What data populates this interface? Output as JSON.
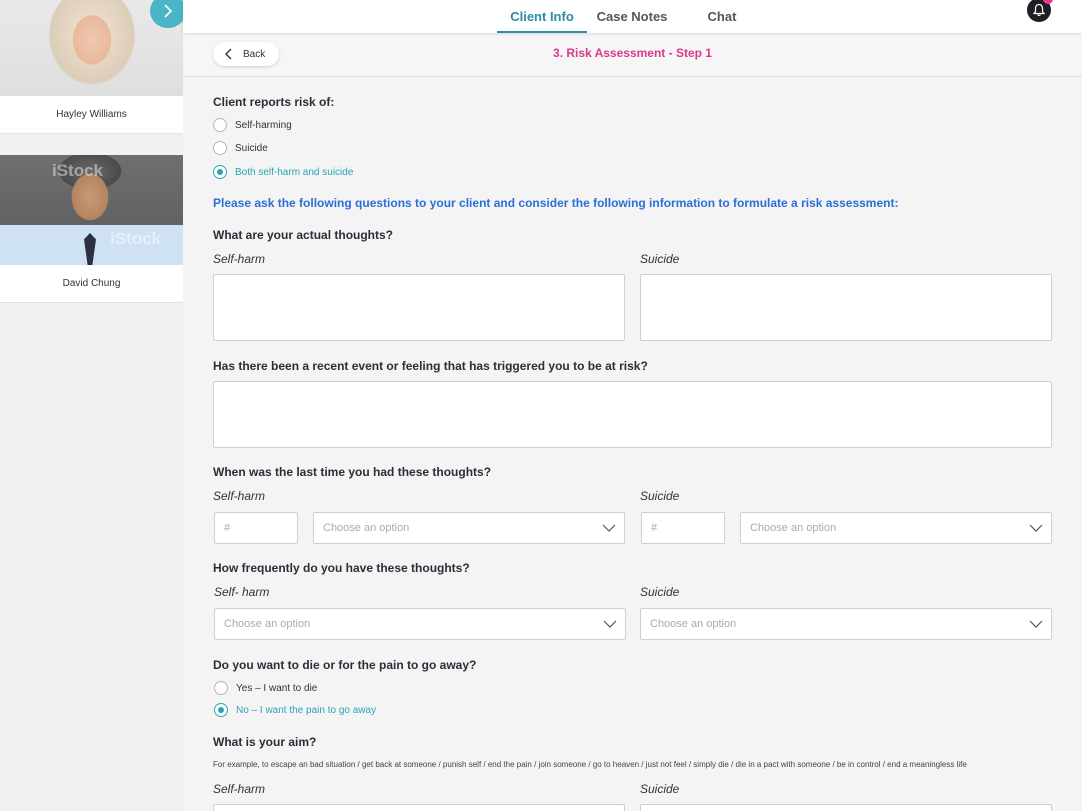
{
  "sidebar": {
    "clients": [
      {
        "name": "Hayley Williams"
      },
      {
        "name": "David Chung",
        "watermark": "iStock"
      }
    ]
  },
  "nav": {
    "tabs": [
      {
        "label": "Client Info",
        "active": true
      },
      {
        "label": "Case Notes",
        "active": false
      },
      {
        "label": "Chat",
        "active": false
      }
    ]
  },
  "header": {
    "back_label": "Back",
    "step_title": "3. Risk Assessment - Step 1"
  },
  "colors": {
    "accent": "#2b8da6",
    "pink": "#d93a8e",
    "instruction_blue": "#2b6fd6",
    "selected_teal": "#2ba3b4"
  },
  "form": {
    "risk_question": "Client reports risk of:",
    "risk_options": [
      {
        "label": "Self-harming",
        "checked": false
      },
      {
        "label": "Suicide",
        "checked": false
      },
      {
        "label": "Both self-harm and suicide",
        "checked": true
      }
    ],
    "instruction": "Please ask the following questions to your client and consider the following information to formulate a risk assessment:",
    "q_thoughts": "What are your actual thoughts?",
    "label_selfharm": "Self-harm",
    "label_suicide": "Suicide",
    "label_selfharm_spaced": "Self- harm",
    "q_trigger": "Has there been a recent event or feeling that has triggered you to be at risk?",
    "q_last_time": "When was the last time you had these thoughts?",
    "number_placeholder": "#",
    "select_placeholder": "Choose an option",
    "q_frequency": "How frequently do you have these thoughts?",
    "q_die": "Do you want to die or for the pain to go away?",
    "die_options": [
      {
        "label": "Yes – I want to die",
        "checked": false
      },
      {
        "label": "No – I want the pain to go away",
        "checked": true
      }
    ],
    "q_aim": "What is your aim?",
    "aim_hint": "For example, to escape an bad situation / get back at someone / punish self / end the pain / join someone / go to heaven / just not feel / simply die / die in a pact with someone / be in control / end a meaningless life"
  }
}
